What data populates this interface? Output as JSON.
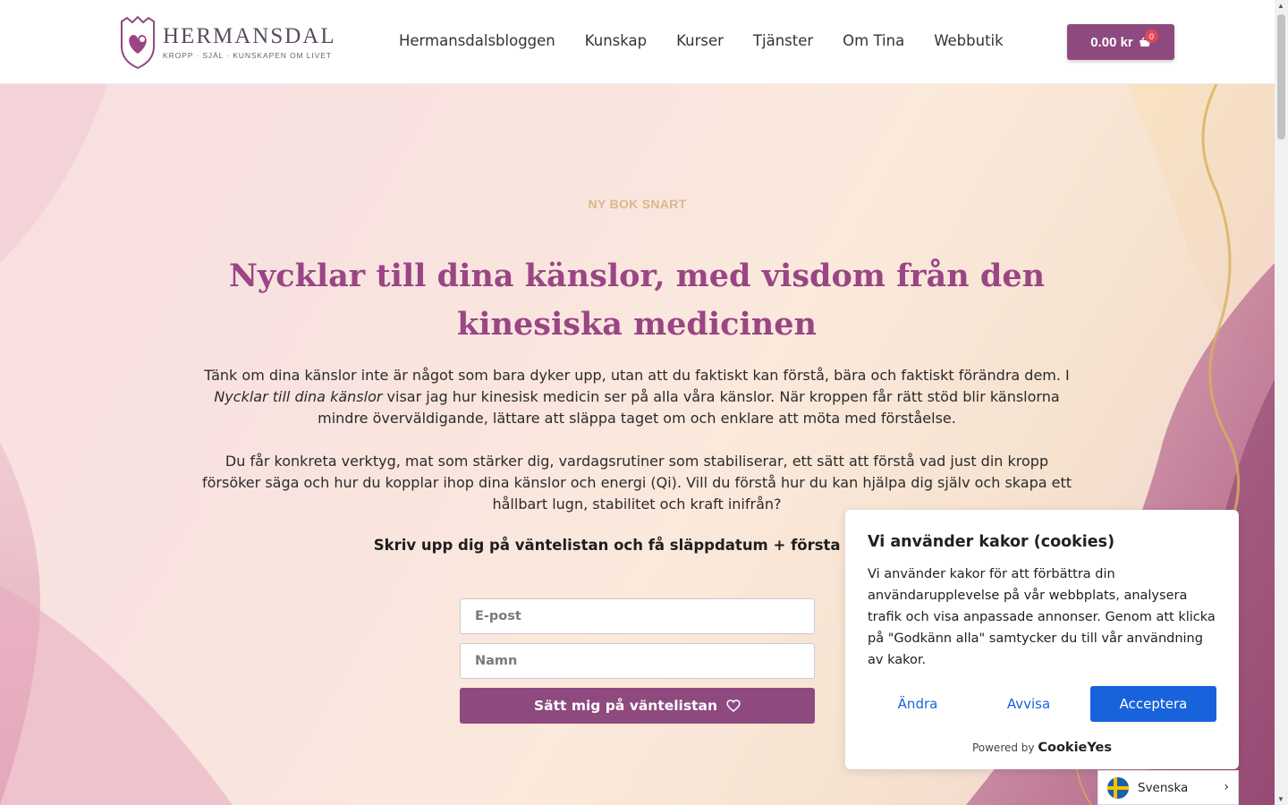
{
  "header": {
    "logo": {
      "name": "HERMANSDAL",
      "tagline": "KROPP · SJÄL · KUNSKAPEN OM LIVET"
    },
    "nav": [
      "Hermansdalsbloggen",
      "Kunskap",
      "Kurser",
      "Tjänster",
      "Om Tina",
      "Webbutik"
    ],
    "cart": {
      "amount": "0.00 kr",
      "count": "0"
    }
  },
  "hero": {
    "eyebrow": "NY BOK SNART",
    "title": "Nycklar till dina känslor, med visdom från den kinesiska medicinen",
    "paragraph1": {
      "before": "Tänk om dina känslor inte är något som bara dyker upp, utan att du faktiskt kan förstå, bära och faktiskt förändra dem. I ",
      "italic": "Nycklar till dina känslor",
      "after": " visar jag hur kinesisk medicin ser på alla våra känslor. När kroppen får rätt stöd blir känslorna mindre överväldigande, lättare att släppa taget om och enklare att möta med förståelse."
    },
    "paragraph2": "Du får konkreta verktyg, mat som stärker dig, vardagsrutiner som stabiliserar, ett sätt att förstå vad just din kropp försöker säga och hur du kopplar ihop dina känslor och energi (Qi). Vill du förstå hur du kan  hjälpa dig  själv och skapa ett hållbart lugn, stabilitet och kraft inifrån?",
    "cta": "Skriv upp dig på väntelistan och få släppdatum + första smakp",
    "form": {
      "email_placeholder": "E-post",
      "name_placeholder": "Namn",
      "submit": "Sätt mig på väntelistan"
    }
  },
  "cookie": {
    "title": "Vi använder kakor (cookies)",
    "text": "Vi använder kakor för att förbättra din användarupplevelse på vår webbplats, analysera trafik och visa anpassade annonser. Genom att klicka på \"Godkänn alla\" samtycker du till vår användning av kakor.",
    "buttons": {
      "change": "Ändra",
      "reject": "Avvisa",
      "accept": "Acceptera"
    },
    "powered_by": "Powered by",
    "brand": "CookieYes"
  },
  "language": {
    "label": "Svenska"
  },
  "colors": {
    "brand": "#8e4a7f",
    "title": "#9a4584",
    "eyebrow": "#d9b88a",
    "cookie_accent": "#1863dc"
  }
}
